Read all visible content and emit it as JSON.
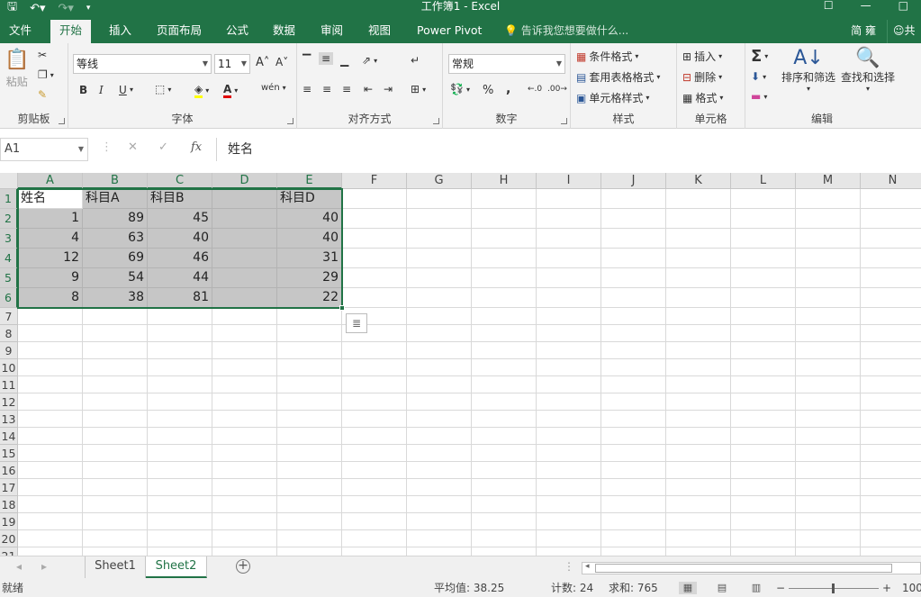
{
  "titlebar": {
    "title": "工作簿1 - Excel",
    "save_icon": "save-icon",
    "undo_icon": "undo-icon",
    "redo_icon": "redo-icon",
    "customize_icon": "customize-qat-icon"
  },
  "tabs": [
    "文件",
    "开始",
    "插入",
    "页面布局",
    "公式",
    "数据",
    "审阅",
    "视图",
    "Power Pivot"
  ],
  "active_tab": "开始",
  "tell_me": "告诉我您想要做什么...",
  "user_name": "简 雍",
  "share_label": "共",
  "ribbon": {
    "clipboard": {
      "label": "剪贴板",
      "paste": "粘贴"
    },
    "font": {
      "label": "字体",
      "name": "等线",
      "size": "11",
      "bold": "B",
      "italic": "I",
      "underline": "U"
    },
    "alignment": {
      "label": "对齐方式"
    },
    "number": {
      "label": "数字",
      "format": "常规",
      "percent": "%",
      "comma": ","
    },
    "styles": {
      "label": "样式",
      "conditional": "条件格式",
      "table": "套用表格格式",
      "cell": "单元格样式"
    },
    "cells": {
      "label": "单元格",
      "insert": "插入",
      "delete": "删除",
      "format": "格式"
    },
    "editing": {
      "label": "编辑",
      "sort": "排序和筛选",
      "find": "查找和选择"
    }
  },
  "formula_bar": {
    "name_box": "A1",
    "formula": "姓名",
    "fx": "fx"
  },
  "columns": [
    "A",
    "B",
    "C",
    "D",
    "E",
    "F",
    "G",
    "H",
    "I",
    "J",
    "K",
    "L",
    "M",
    "N"
  ],
  "rows": [
    "1",
    "2",
    "3",
    "4",
    "5",
    "6",
    "7",
    "8",
    "9",
    "10",
    "11",
    "12",
    "13",
    "14",
    "15",
    "16",
    "17",
    "18",
    "19",
    "20",
    "21"
  ],
  "cells": {
    "A1": "姓名",
    "B1": "科目A",
    "C1": "科目B",
    "E1": "科目D",
    "A2": "1",
    "B2": "89",
    "C2": "45",
    "E2": "40",
    "A3": "4",
    "B3": "63",
    "C3": "40",
    "E3": "40",
    "A4": "12",
    "B4": "69",
    "C4": "46",
    "E4": "31",
    "A5": "9",
    "B5": "54",
    "C5": "44",
    "E5": "29",
    "A6": "8",
    "B6": "38",
    "C6": "81",
    "E6": "22"
  },
  "sheets": [
    "Sheet1",
    "Sheet2"
  ],
  "active_sheet": "Sheet2",
  "status": {
    "ready": "就绪",
    "average": "平均值: 38.25",
    "count": "计数: 24",
    "sum": "求和: 765",
    "zoom": "100"
  },
  "colors": {
    "accent": "#217346",
    "selection": "#c6c6c6"
  }
}
